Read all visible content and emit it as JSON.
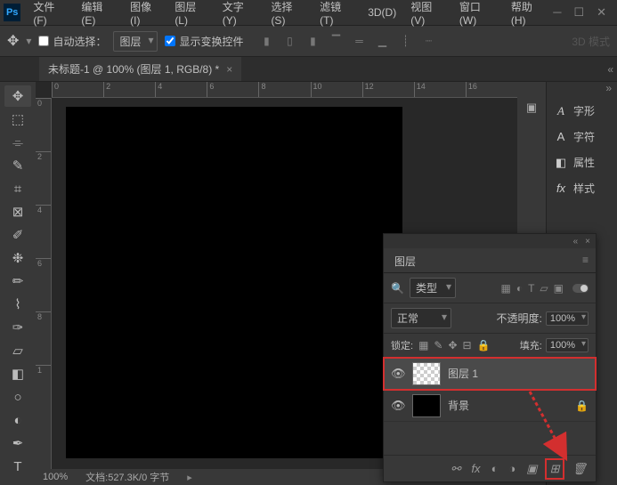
{
  "menubar": {
    "items": [
      "文件(F)",
      "编辑(E)",
      "图像(I)",
      "图层(L)",
      "文字(Y)",
      "选择(S)",
      "滤镜(T)",
      "3D(D)",
      "视图(V)",
      "窗口(W)",
      "帮助(H)"
    ]
  },
  "optionsbar": {
    "auto_select": "自动选择：",
    "select_target": "图层",
    "show_transform": "显示变换控件",
    "mode_3d": "3D 模式"
  },
  "document": {
    "tab_title": "未标题-1 @ 100% (图层 1, RGB/8) *",
    "zoom": "100%",
    "status": "文档:527.3K/0 字节"
  },
  "ruler_h": [
    "0",
    "2",
    "4",
    "6",
    "8",
    "10",
    "12",
    "14",
    "16"
  ],
  "ruler_v": [
    "0",
    "2",
    "4",
    "6",
    "8",
    "1"
  ],
  "right_panels": {
    "items": [
      {
        "icon": "A",
        "label": "字形"
      },
      {
        "icon": "A|",
        "label": "字符"
      },
      {
        "icon": "◧",
        "label": "属性"
      },
      {
        "icon": "fx",
        "label": "样式"
      }
    ]
  },
  "layers_panel": {
    "title": "图层",
    "filter_label": "类型",
    "blend_mode": "正常",
    "opacity_label": "不透明度:",
    "opacity_value": "100%",
    "lock_label": "锁定:",
    "fill_label": "填充:",
    "fill_value": "100%",
    "layers": [
      {
        "name": "图层 1",
        "selected": true,
        "checker": true,
        "locked": false
      },
      {
        "name": "背景",
        "selected": false,
        "checker": false,
        "locked": true
      }
    ],
    "footer_search_icon": "🔍"
  }
}
